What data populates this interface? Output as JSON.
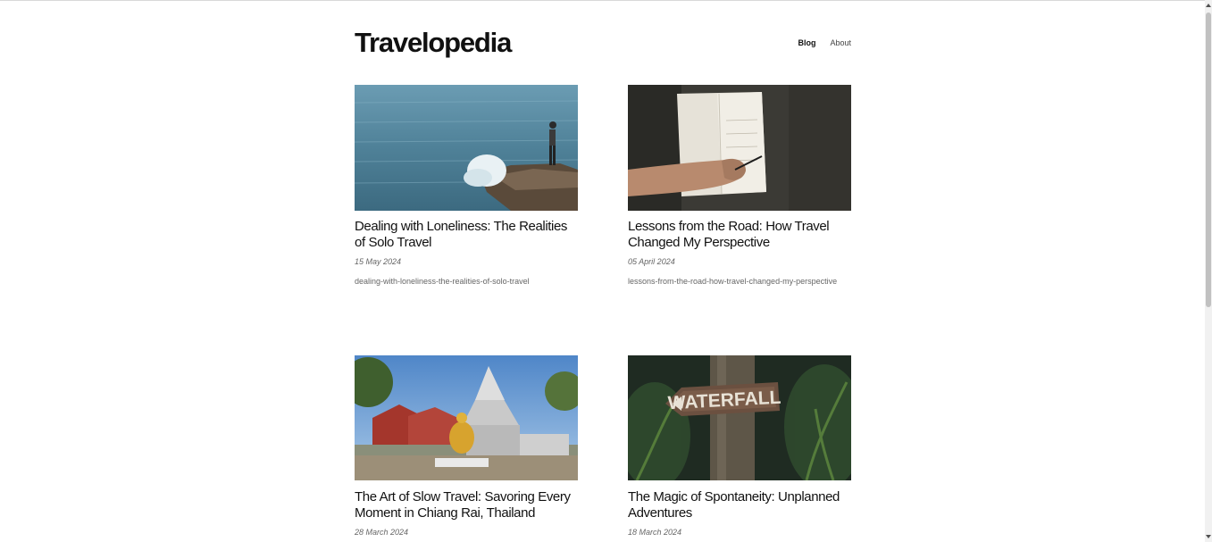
{
  "site": {
    "title": "Travelopedia"
  },
  "nav": {
    "items": [
      {
        "label": "Blog",
        "active": true
      },
      {
        "label": "About",
        "active": false
      }
    ]
  },
  "posts": [
    {
      "title": "Dealing with Loneliness: The Realities of Solo Travel",
      "date": "15 May 2024",
      "slug": "dealing-with-loneliness-the-realities-of-solo-travel",
      "image": "person-standing-on-rocks-by-sea"
    },
    {
      "title": "Lessons from the Road: How Travel Changed My Perspective",
      "date": "05 April 2024",
      "slug": "lessons-from-the-road-how-travel-changed-my-perspective",
      "image": "hand-writing-in-notebook"
    },
    {
      "title": "The Art of Slow Travel: Savoring Every Moment in Chiang Rai, Thailand",
      "date": "28 March 2024",
      "slug": "",
      "image": "silver-temple-with-golden-buddha"
    },
    {
      "title": "The Magic of Spontaneity: Unplanned Adventures",
      "date": "18 March 2024",
      "slug": "",
      "image": "waterfall-sign-on-tree"
    }
  ],
  "image_text": {
    "sign": "WATERFALL"
  },
  "colors": {
    "text": "#111111",
    "meta": "#666666"
  }
}
